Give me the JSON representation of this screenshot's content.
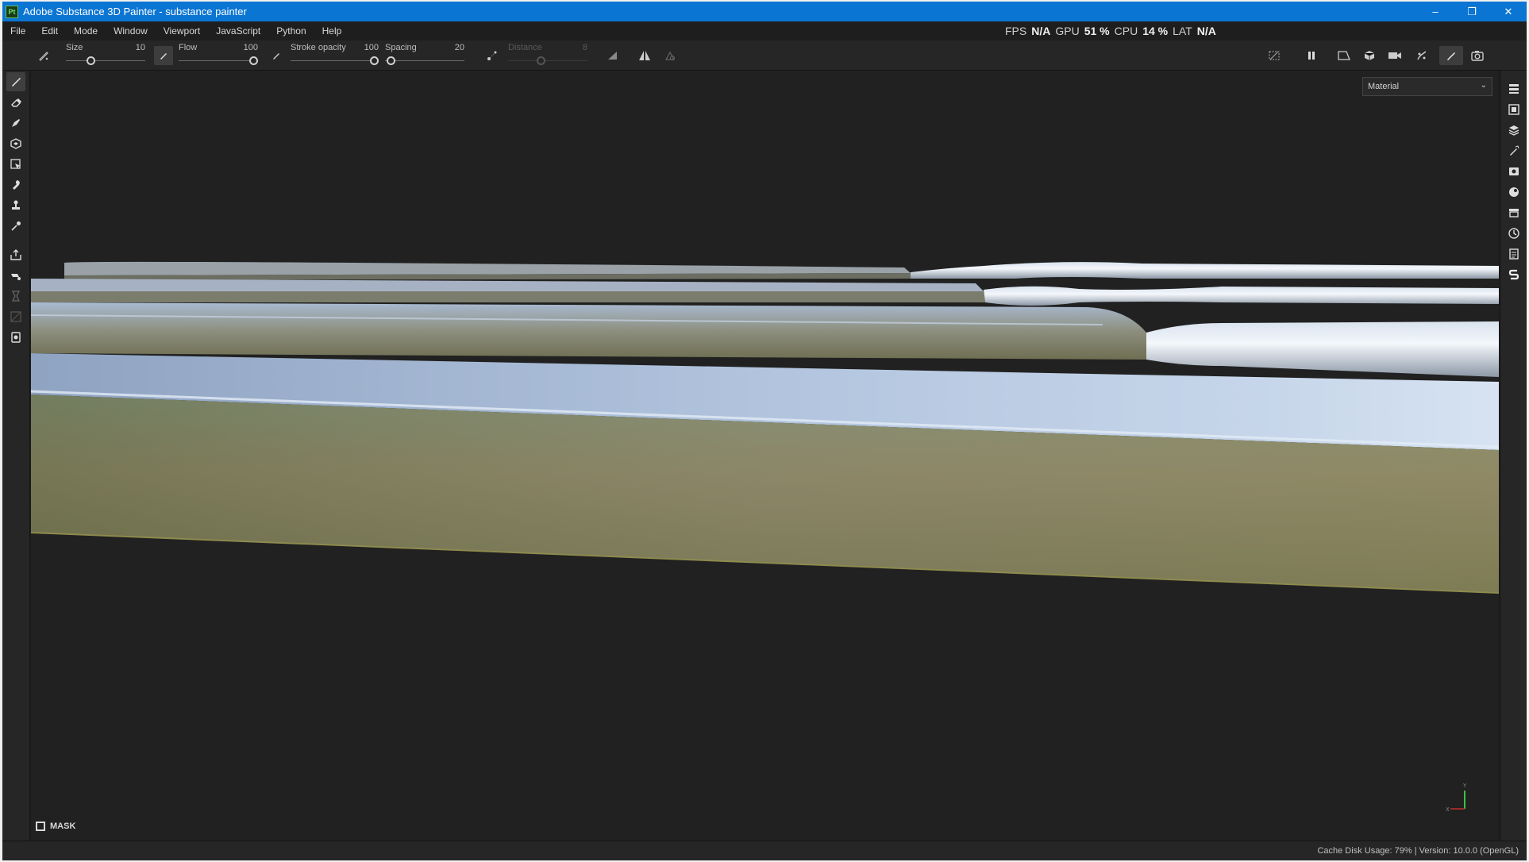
{
  "window": {
    "app_icon_text": "Pt",
    "title": "Adobe Substance 3D Painter - substance painter",
    "minimize": "–",
    "maximize": "❐",
    "close": "✕"
  },
  "menu": {
    "items": [
      "File",
      "Edit",
      "Mode",
      "Window",
      "Viewport",
      "JavaScript",
      "Python",
      "Help"
    ]
  },
  "perf": {
    "fps_label": "FPS",
    "fps_value": "N/A",
    "gpu_label": "GPU",
    "gpu_value": "51 %",
    "cpu_label": "CPU",
    "cpu_value": "14 %",
    "lat_label": "LAT",
    "lat_value": "N/A"
  },
  "tool_options": {
    "size": {
      "label": "Size",
      "value": "10",
      "level": 0.29
    },
    "flow": {
      "label": "Flow",
      "value": "100",
      "level": 1.0
    },
    "stroke_opacity": {
      "label": "Stroke opacity",
      "value": "100",
      "level": 1.0
    },
    "spacing": {
      "label": "Spacing",
      "value": "20",
      "level": 0.02
    },
    "distance": {
      "label": "Distance",
      "value": "8",
      "level": 0.4,
      "enabled": false
    }
  },
  "viewport": {
    "channel_select": "Material",
    "mask_label": "MASK",
    "axis_y": "Y",
    "axis_x": "X"
  },
  "status": {
    "text": "Cache Disk Usage:   79% | Version: 10.0.0 (OpenGL)"
  },
  "colors": {
    "titlebar": "#0a75d2",
    "background": "#212121",
    "panel": "#262626"
  }
}
